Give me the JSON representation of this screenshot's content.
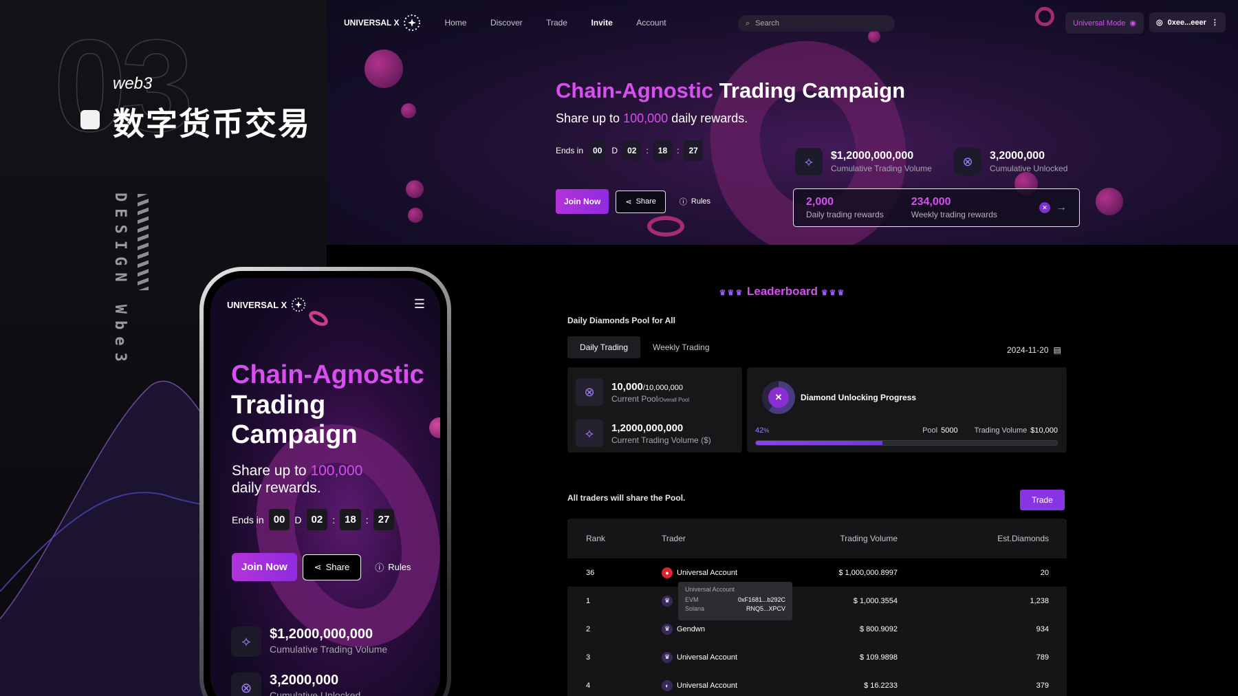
{
  "brand": {
    "logo_text": "UNIVERSAL X"
  },
  "decor": {
    "number": "03",
    "web3": "web3",
    "cn_title": "数字货币交易",
    "vertical": "DESIGN Wbe3"
  },
  "nav": {
    "items": [
      {
        "label": "Home",
        "active": false
      },
      {
        "label": "Discover",
        "active": false
      },
      {
        "label": "Trade",
        "active": false
      },
      {
        "label": "Invite",
        "active": true
      },
      {
        "label": "Account",
        "active": false
      }
    ],
    "search_placeholder": "Search",
    "mode_label": "Universal Mode",
    "wallet": "0xee...eeer"
  },
  "hero": {
    "title_accent": "Chain-Agnostic",
    "title_rest": "Trading Campaign",
    "sub_pre": "Share up to",
    "sub_amount": "100,000",
    "sub_post": "daily rewards.",
    "ends_label": "Ends in",
    "countdown": {
      "days": "00",
      "d": "D",
      "hours": "02",
      "minutes": "18",
      "seconds": "27"
    },
    "join": "Join Now",
    "share": "Share",
    "rules": "Rules",
    "stat1": {
      "value": "$1,2000,000,000",
      "label": "Cumulative Trading Volume"
    },
    "stat2": {
      "value": "3,2000,000",
      "label": "Cumulative Unlocked"
    },
    "daily_reward": {
      "value": "2,000",
      "label": "Daily trading rewards"
    },
    "weekly_reward": {
      "value": "234,000",
      "label": "Weekly trading rewards"
    }
  },
  "mobile": {
    "title_accent": "Chain-Agnostic",
    "title_rest": "Trading Campaign",
    "sub_pre": "Share up to",
    "sub_amount": "100,000",
    "sub_post": "daily rewards."
  },
  "leaderboard": {
    "title": "Leaderboard",
    "pool_label": "Daily Diamonds Pool for All",
    "tabs": [
      {
        "label": "Daily Trading",
        "active": true
      },
      {
        "label": "Weekly Trading",
        "active": false
      }
    ],
    "date": "2024-11-20",
    "pool": {
      "value": "10,000",
      "total": "/10,000,000",
      "label": "Current  Pool",
      "label_small": "/Overall  Pool"
    },
    "volume": {
      "value": "1,2000,000,000",
      "label": "Current Trading Volume ($)"
    },
    "progress": {
      "title": "Diamond Unlocking Progress",
      "percent_text": "42",
      "percent_unit": "%",
      "percent": 0.42,
      "pool_label": "Pool",
      "pool_value": "5000",
      "tv_label": "Trading Volume",
      "tv_value": "$10,000"
    },
    "share_label": "All traders will share the Pool.",
    "trade_button": "Trade",
    "columns": {
      "rank": "Rank",
      "trader": "Trader",
      "volume": "Trading Volume",
      "diamonds": "Est.Diamonds"
    },
    "rows": [
      {
        "rank": "36",
        "trader": "Universal Account",
        "volume": "$ 1,000,000.8997",
        "diamonds": "20"
      },
      {
        "rank": "1",
        "trader": "",
        "volume": "$ 1,000.3554",
        "diamonds": "1,238"
      },
      {
        "rank": "2",
        "trader": "Gendwn",
        "volume": "$ 800.9092",
        "diamonds": "934"
      },
      {
        "rank": "3",
        "trader": "Universal Account",
        "volume": "$ 109.9898",
        "diamonds": "789"
      },
      {
        "rank": "4",
        "trader": "Universal Account",
        "volume": "$ 16.2233",
        "diamonds": "379"
      }
    ],
    "tooltip": {
      "title": "Universal Account",
      "evm_label": "EVM",
      "evm": "0xF1681...b292C",
      "sol_label": "Solana",
      "sol": "RNQ5...XPCV"
    }
  },
  "colors": {
    "accent": "#d84ff0",
    "purple": "#8a35e4",
    "bg": "#000000"
  }
}
